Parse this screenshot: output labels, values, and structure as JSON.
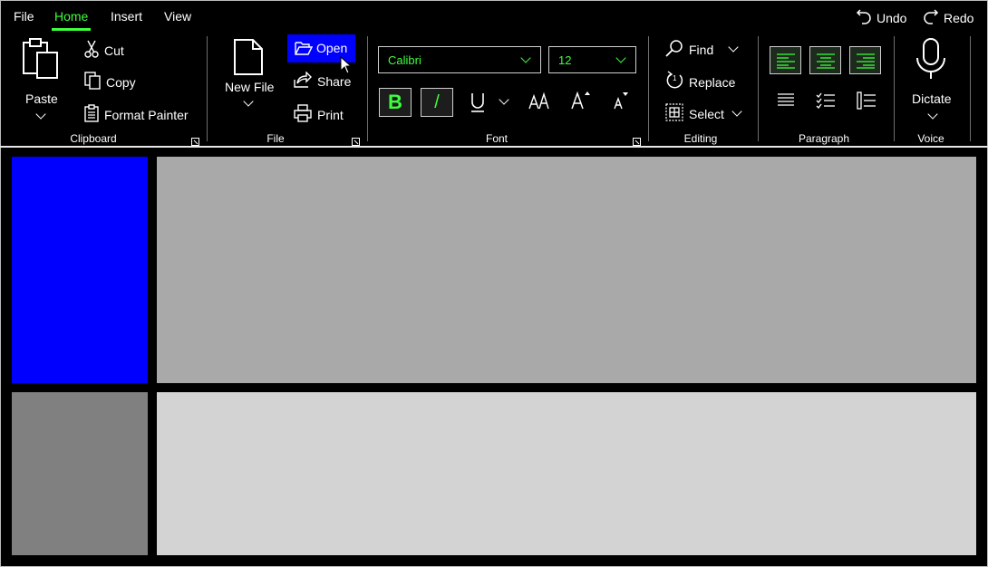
{
  "menu": {
    "tabs": [
      {
        "label": "File"
      },
      {
        "label": "Home"
      },
      {
        "label": "Insert"
      },
      {
        "label": "View"
      }
    ],
    "undo_label": "Undo",
    "redo_label": "Redo"
  },
  "clipboard": {
    "paste_label": "Paste",
    "cut_label": "Cut",
    "copy_label": "Copy",
    "format_painter_label": "Format Painter",
    "group_label": "Clipboard"
  },
  "file": {
    "new_file_label": "New File",
    "open_label": "Open",
    "share_label": "Share",
    "print_label": "Print",
    "group_label": "File"
  },
  "font": {
    "family_value": "Calibri",
    "size_value": "12",
    "bold_label": "B",
    "italic_label": "/",
    "group_label": "Font"
  },
  "editing": {
    "find_label": "Find",
    "replace_label": "Replace",
    "select_label": "Select",
    "group_label": "Editing"
  },
  "paragraph": {
    "group_label": "Paragraph"
  },
  "voice": {
    "dictate_label": "Dictate",
    "group_label": "Voice"
  },
  "colors": {
    "accent": "#3dff3d",
    "highlight": "#0000ff",
    "panel_blue": "#0000ff",
    "panel_gray_top": "#a9a9a9",
    "panel_gray_left": "#808080",
    "panel_light": "#d3d3d3"
  }
}
